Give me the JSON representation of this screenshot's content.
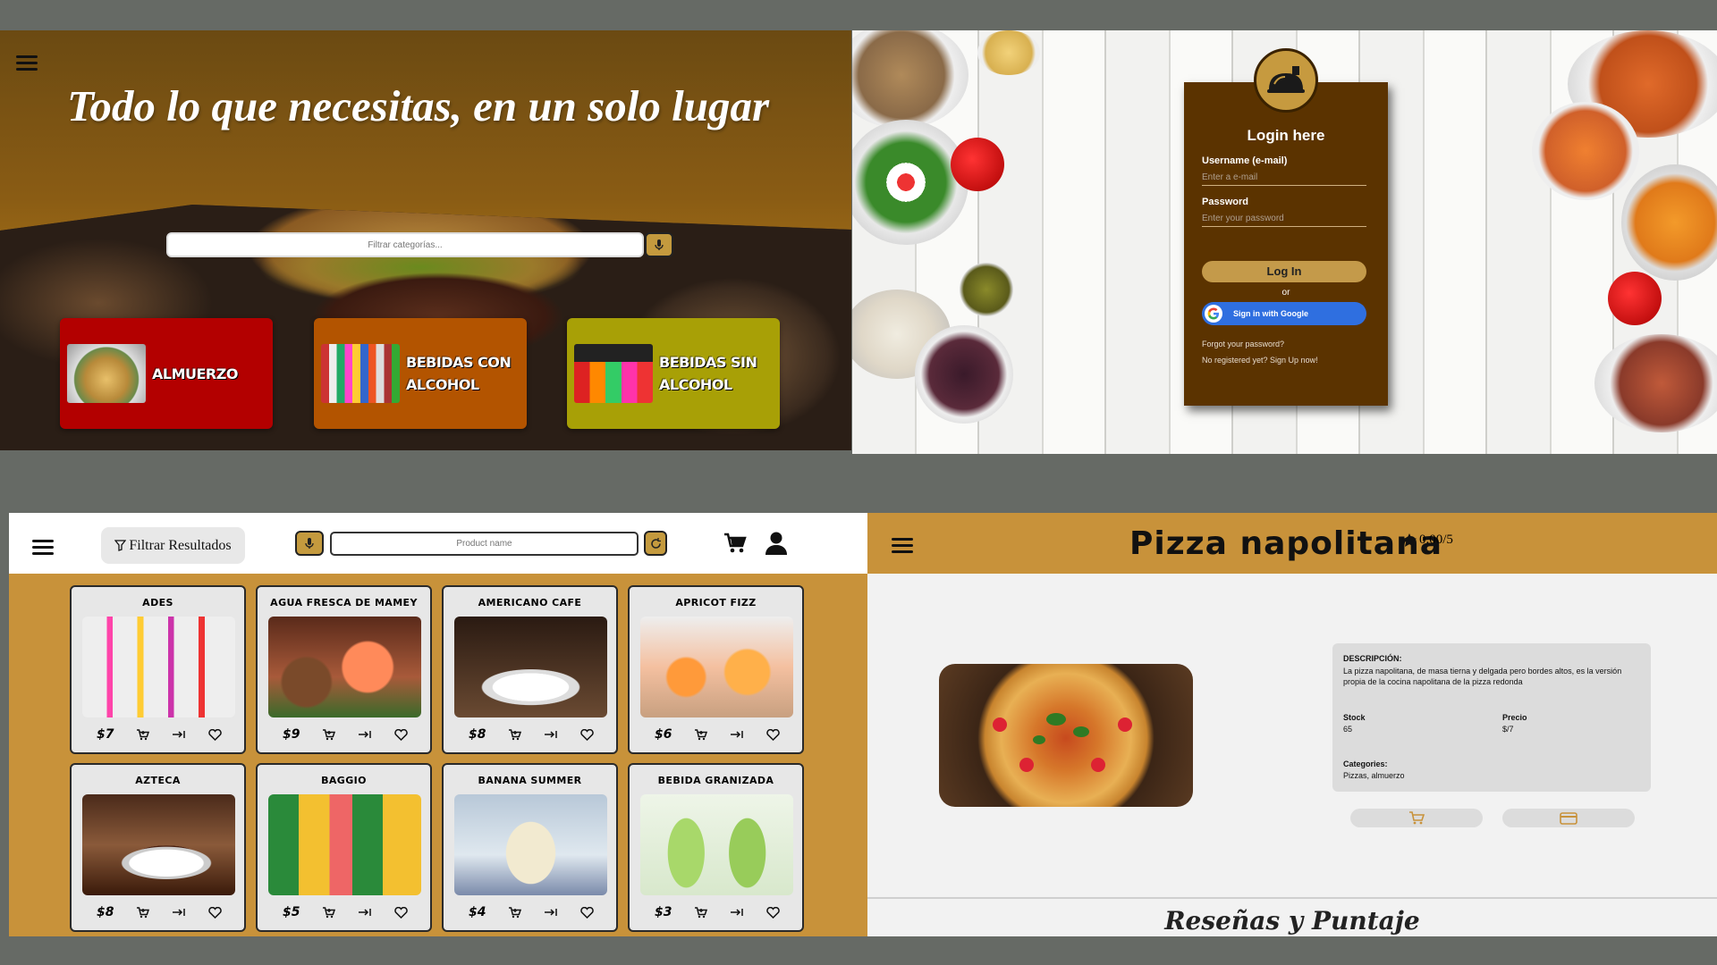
{
  "hero": {
    "headline": "Todo lo que necesitas, en un solo lugar",
    "search_placeholder": "Filtrar categorías...",
    "categories": [
      {
        "label": "Almuerzo",
        "color": "#b30000"
      },
      {
        "label": "Bebidas con alcohol",
        "color": "#b35400"
      },
      {
        "label": "Bebidas sin alcohol",
        "color": "#a8a006"
      }
    ]
  },
  "login": {
    "title": "Login here",
    "username_label": "Username (e-mail)",
    "username_placeholder": "Enter a e-mail",
    "password_label": "Password",
    "password_placeholder": "Enter your password",
    "login_button": "Log In",
    "or_text": "or",
    "google_button": "Sign in with Google",
    "forgot_link": "Forgot your password?",
    "signup_link": "No registered yet? Sign Up now!",
    "panel_color": "#5b3300"
  },
  "shop": {
    "filter_label": "Filtrar Resultados",
    "search_placeholder": "Product name",
    "accent": "#c8923a",
    "products": [
      {
        "name": "Ades",
        "price": "$7"
      },
      {
        "name": "Agua fresca de mamey",
        "price": "$9"
      },
      {
        "name": "Americano Cafe",
        "price": "$8"
      },
      {
        "name": "Apricot Fizz",
        "price": "$6"
      },
      {
        "name": "Azteca",
        "price": "$8"
      },
      {
        "name": "Baggio",
        "price": "$5"
      },
      {
        "name": "Banana Summer",
        "price": "$4"
      },
      {
        "name": "Bebida Granizada",
        "price": "$3"
      }
    ]
  },
  "detail": {
    "title": "Pizza napolitana",
    "rating": "0.00/5",
    "description_label": "DESCRIPCIÓN:",
    "description": "La pizza napolitana, de masa tierna y delgada pero bordes altos, es la versión propia de la cocina napolitana de la pizza redonda",
    "stock_label": "Stock",
    "stock_value": "65",
    "price_label": "Precio",
    "price_value": "$/7",
    "categories_label": "Categories:",
    "categories_value": "Pizzas, almuerzo",
    "reviews_title": "Reseñas y Puntaje"
  }
}
